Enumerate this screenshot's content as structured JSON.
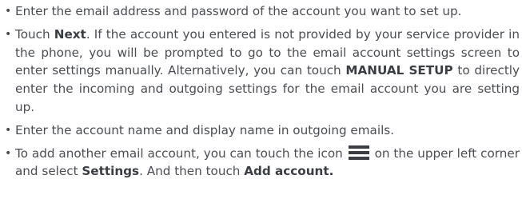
{
  "bullets": [
    {
      "text": "Enter the email address and password of the account you want to set up."
    },
    {
      "t1": "Touch ",
      "b1": "Next",
      "t2": ". If the account you entered is not provided by your service provider in the phone, you will be prompted to go to the email account settings screen to enter settings manually. Alternatively, you can touch ",
      "b2": "MANUAL SETUP",
      "t3": " to directly enter the incoming and outgoing settings for the email account you are setting up."
    },
    {
      "text": "Enter the account name and display name in outgoing emails."
    },
    {
      "t1": "To add another email account, you can touch the icon",
      "icon": "menu-icon",
      "t2": "on the upper left corner and select ",
      "b1": "Settings",
      "t3": ".  And then touch ",
      "b2": "Add account",
      "t4": "."
    }
  ],
  "bullet_glyph": "•",
  "colors": {
    "text": "#4a4d52",
    "icon": "#3a3d42"
  }
}
